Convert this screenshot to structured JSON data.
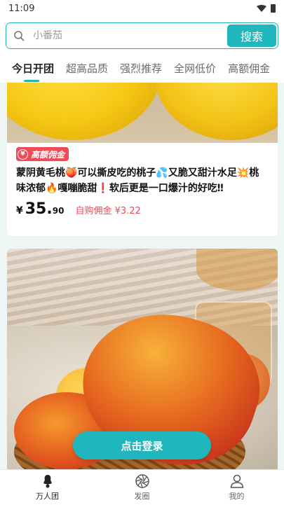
{
  "status_bar": {
    "time": "11:09"
  },
  "search": {
    "placeholder": "小番茄",
    "button_label": "搜索"
  },
  "tabs": [
    {
      "label": "今日开团",
      "active": true
    },
    {
      "label": "超高品质",
      "active": false
    },
    {
      "label": "强烈推荐",
      "active": false
    },
    {
      "label": "全网低价",
      "active": false
    },
    {
      "label": "高额佣金",
      "active": false
    }
  ],
  "products": [
    {
      "badge": "高额佣金",
      "badge_icon": "yen-icon",
      "title": "蒙阴黄毛桃🍑可以撕皮吃的桃子💦又脆又甜汁水足💥桃味浓郁🔥嘎嘣脆甜❗软后更是一口爆汁的好吃‼",
      "currency": "¥",
      "price_int": "35.",
      "price_dec": "90",
      "commission": "自购佣金 ¥3.22"
    }
  ],
  "login_button": "点击登录",
  "bottom_nav": [
    {
      "label": "万人团",
      "icon": "group-icon",
      "active": true
    },
    {
      "label": "发圈",
      "icon": "camera-aperture-icon",
      "active": false
    },
    {
      "label": "我的",
      "icon": "user-icon",
      "active": false
    }
  ],
  "colors": {
    "accent": "#1fb7bd",
    "badge_red": "#f04a57"
  }
}
